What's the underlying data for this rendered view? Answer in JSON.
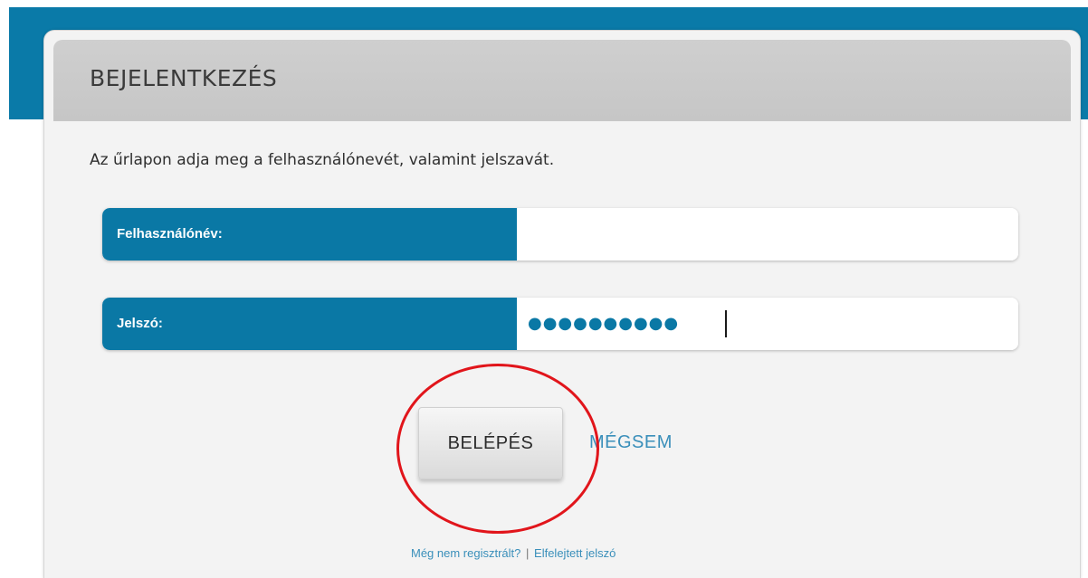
{
  "dialog": {
    "title": "BEJELENTKEZÉS",
    "instruction": "Az űrlapon adja meg a felhasználónevét, valamint jelszavát."
  },
  "form": {
    "username": {
      "label": "Felhasználónév:",
      "value": ""
    },
    "password": {
      "label": "Jelszó:",
      "masked_value": "●●●●●●●●●●"
    }
  },
  "actions": {
    "login_label": "BELÉPÉS",
    "cancel_label": "MÉGSEM"
  },
  "links": {
    "register": "Még nem regisztrált?",
    "separator": "|",
    "forgot_password": "Elfelejtett jelszó"
  },
  "colors": {
    "brand_blue": "#0a78a5",
    "link_blue": "#3a8fba",
    "highlight_red": "#e1151b"
  }
}
